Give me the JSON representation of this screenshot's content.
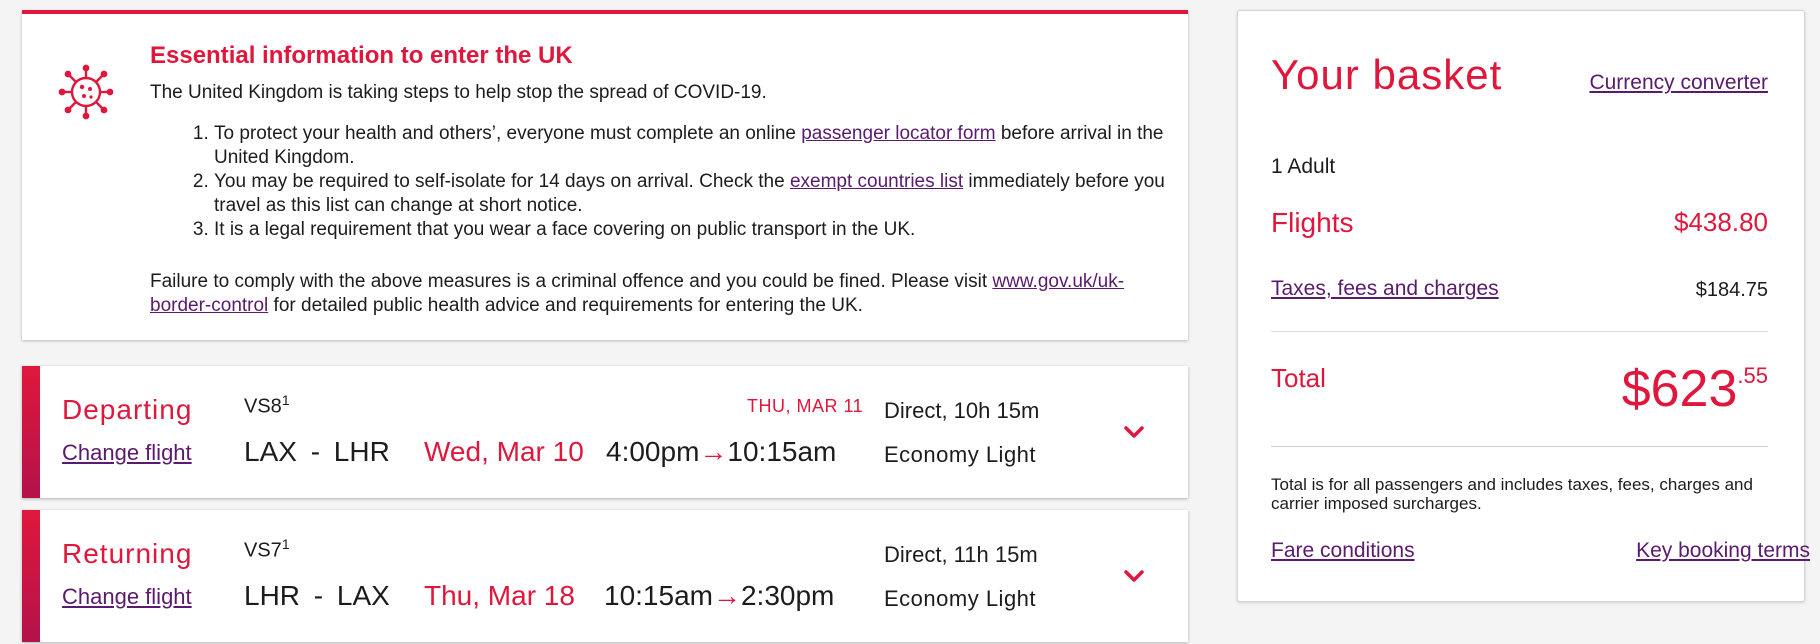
{
  "notice": {
    "title": "Essential information to enter the UK",
    "intro": "The United Kingdom is taking steps to help stop the spread of COVID-19.",
    "items": [
      {
        "pre": "To protect your health and others’, everyone must complete an online ",
        "link": "passenger locator form",
        "post": " before arrival in the United Kingdom."
      },
      {
        "pre": "You may be required to self-isolate for 14 days on arrival. Check the ",
        "link": "exempt countries list",
        "post": " immediately before you travel as this list can change at short notice."
      },
      {
        "pre": "It is a legal requirement that you wear a face covering on public transport in the UK.",
        "link": "",
        "post": ""
      }
    ],
    "outro_pre": "Failure to comply with the above measures is a criminal offence and you could be fined. Please visit ",
    "outro_link": "www.gov.uk/uk-border-control",
    "outro_post": " for detailed public health advice and requirements for entering the UK.",
    "icon": "virus-icon"
  },
  "flights": [
    {
      "direction": "Departing",
      "change_label": "Change flight",
      "flight_number": "VS8",
      "footnote": "1",
      "route": "LAX - LHR",
      "date": "Wed, Mar 10",
      "arrival_date": "THU, MAR 11",
      "depart_time": "4:00pm",
      "arrow": "→",
      "arrive_time": "10:15am",
      "stops": "Direct, 10h 15m",
      "cabin": "Economy Light"
    },
    {
      "direction": "Returning",
      "change_label": "Change flight",
      "flight_number": "VS7",
      "footnote": "1",
      "route": "LHR - LAX",
      "date": "Thu, Mar 18",
      "arrival_date": "",
      "depart_time": "10:15am",
      "arrow": "→",
      "arrive_time": "2:30pm",
      "stops": "Direct, 11h 15m",
      "cabin": "Economy Light"
    }
  ],
  "basket": {
    "title": "Your basket",
    "currency_converter": "Currency converter",
    "passengers": "1 Adult",
    "flights_label": "Flights",
    "flights_value": "$438.80",
    "taxes_label": "Taxes, fees and charges",
    "taxes_value": "$184.75",
    "total_label": "Total",
    "total_main": "$623",
    "total_cents": ".55",
    "note": "Total is for all passengers and includes taxes, fees, charges and carrier imposed surcharges.",
    "fare_conditions": "Fare conditions",
    "key_terms": "Key booking terms"
  },
  "colors": {
    "accent": "#e0173c",
    "link": "#5a1a6e"
  }
}
